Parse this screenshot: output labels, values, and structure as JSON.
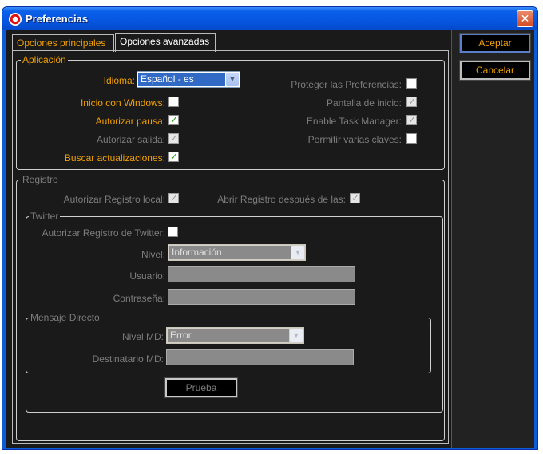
{
  "window": {
    "title": "Preferencias",
    "close_symbol": "✕"
  },
  "tabs": [
    {
      "label": "Opciones principales"
    },
    {
      "label": "Opciones avanzadas"
    }
  ],
  "buttons": {
    "accept": "Aceptar",
    "cancel": "Cancelar",
    "test": "Prueba"
  },
  "application": {
    "legend": "Aplicación",
    "language_label": "Idioma:",
    "language_value": "Español - es",
    "start_with_windows": "Inicio con Windows:",
    "allow_pause": "Autorizar pausa:",
    "allow_exit": "Autorizar salida:",
    "check_updates": "Buscar actualizaciones:",
    "protect_preferences": "Proteger las Preferencias:",
    "splash_screen": "Pantalla de inicio:",
    "enable_task_manager": "Enable Task Manager:",
    "allow_multiple_keys": "Permitir varias claves:"
  },
  "log": {
    "legend": "Registro",
    "allow_local_log": "Autorizar Registro local:",
    "open_log_after": "Abrir Registro después de las:"
  },
  "twitter": {
    "legend": "Twitter",
    "allow_twitter_log": "Autorizar Registro de Twitter:",
    "level_label": "Nivel:",
    "level_value": "Información",
    "user_label": "Usuario:",
    "password_label": "Contraseña:"
  },
  "direct_message": {
    "legend": "Mensaje Directo",
    "level_label": "Nivel MD:",
    "level_value": "Error",
    "recipient_label": "Destinatario MD:"
  },
  "colors": {
    "accent": "#f0a000",
    "background": "#1a1a1a",
    "disabled_text": "#7c7c7c"
  }
}
